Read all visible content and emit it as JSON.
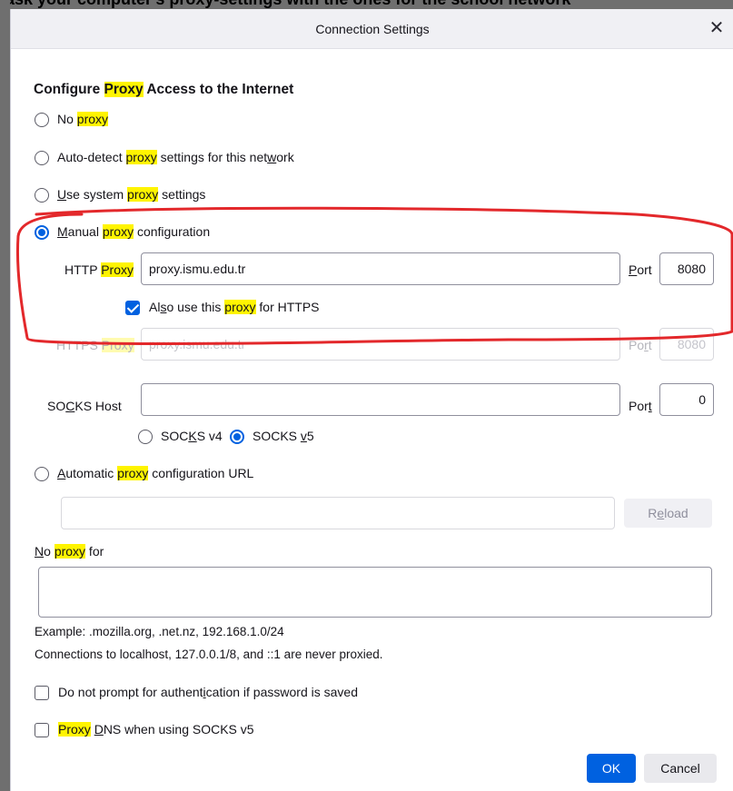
{
  "dialog": {
    "title": "Connection Settings",
    "close_glyph": "✕"
  },
  "heading": {
    "pre": "Configure ",
    "hl": "Proxy",
    "post": " Access to the Internet"
  },
  "options": {
    "no_proxy": {
      "pre": "No ",
      "hl": "proxy"
    },
    "auto_detect": {
      "pre": "Auto-detect ",
      "hl": "proxy",
      "post_a": " settings for this net",
      "ul": "w",
      "post_b": "ork"
    },
    "system": {
      "ul": "U",
      "pre": "se system ",
      "hl": "proxy",
      "post": " settings"
    },
    "manual": {
      "ul": "M",
      "pre": "anual ",
      "hl": "proxy",
      "post": " configuration"
    },
    "auto_url": {
      "ul": "A",
      "pre": "utomatic ",
      "hl": "proxy",
      "post": " configuration URL"
    }
  },
  "http": {
    "label_pre": "HTTP ",
    "label_hl": "Proxy",
    "value": "proxy.ismu.edu.tr",
    "port_ul": "P",
    "port_rest": "ort",
    "port": "8080"
  },
  "also_https": {
    "pre": "Al",
    "ul": "s",
    "post_a": "o use this ",
    "hl": "proxy",
    "post_b": " for HTTPS"
  },
  "https": {
    "label_pre": "HTTPS ",
    "label_hl": "Proxy",
    "value": "proxy.ismu.edu.tr",
    "port_pre": "Po",
    "port_ul": "r",
    "port_post": "t",
    "port": "8080"
  },
  "socks": {
    "label_pre": "SO",
    "label_ul": "C",
    "label_post": "KS Host",
    "value": "",
    "port_pre": "Por",
    "port_ul": "t",
    "port": "0",
    "v4_pre": "SOC",
    "v4_ul": "K",
    "v4_post": "S v4",
    "v5_pre": "SOCKS ",
    "v5_ul": "v",
    "v5_post": "5"
  },
  "pac": {
    "value": "",
    "reload_pre": "R",
    "reload_ul": "e",
    "reload_post": "load"
  },
  "no_proxy_for": {
    "ul": "N",
    "pre": "o ",
    "hl": "proxy",
    "post": " for",
    "value": ""
  },
  "example": "Example: .mozilla.org, .net.nz, 192.168.1.0/24",
  "localhost_note": "Connections to localhost, 127.0.0.1/8, and ::1 are never proxied.",
  "no_auth_prompt": {
    "pre": "Do not prompt for authent",
    "ul": "i",
    "post": "cation if password is saved"
  },
  "proxy_dns": {
    "hl": "Proxy",
    "sp": " ",
    "ul": "D",
    "post": "NS when using SOCKS v5"
  },
  "buttons": {
    "ok": "OK",
    "cancel": "Cancel"
  },
  "background_strip_text": "ask your computer's proxy-settings with the ones for the school network",
  "colors": {
    "accent": "#0061e0",
    "highlight": "#fff400",
    "annotation": "#e3282b"
  }
}
